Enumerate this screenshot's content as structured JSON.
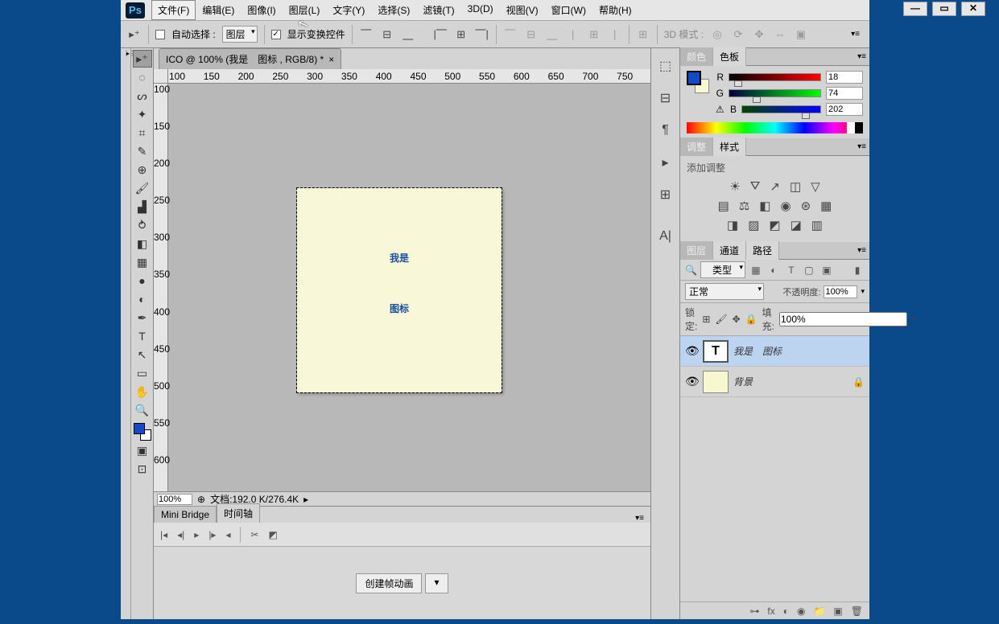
{
  "menu": [
    "文件(F)",
    "编辑(E)",
    "图像(I)",
    "图层(L)",
    "文字(Y)",
    "选择(S)",
    "滤镜(T)",
    "3D(D)",
    "视图(V)",
    "窗口(W)",
    "帮助(H)"
  ],
  "opt": {
    "auto": "自动选择 :",
    "layerSel": "图层",
    "show": "显示变换控件",
    "mode": "3D 模式 :"
  },
  "doc": {
    "tab": "ICO @ 100% (我是　图标 , RGB/8) *"
  },
  "rulerH": [
    "100",
    "150",
    "200",
    "250",
    "300",
    "350",
    "400",
    "450",
    "500",
    "550",
    "600",
    "650",
    "700",
    "750"
  ],
  "rulerV": [
    "100",
    "150",
    "200",
    "250",
    "300",
    "350",
    "400",
    "450",
    "500",
    "550",
    "600"
  ],
  "canvas": {
    "line1": "我是",
    "line2": "图标"
  },
  "status": {
    "zoom": "100%",
    "doc": "文档:192.0 K/276.4K"
  },
  "colorPnl": {
    "tab1": "颜色",
    "tab2": "色板",
    "r": "18",
    "g": "74",
    "b": "202",
    "rl": "R",
    "gl": "G",
    "bl": "B"
  },
  "adjPnl": {
    "tab1": "调整",
    "tab2": "样式",
    "add": "添加调整"
  },
  "layersPnl": {
    "tab1": "图层",
    "tab2": "通道",
    "tab3": "路径",
    "filter": "类型",
    "blend": "正常",
    "opLbl": "不透明度:",
    "op": "100%",
    "lockLbl": "锁定:",
    "fillLbl": "填充:",
    "fill": "100%"
  },
  "layers": [
    {
      "name": "我是　图标",
      "type": "T",
      "sel": true,
      "locked": false
    },
    {
      "name": "背景",
      "type": "bg",
      "sel": false,
      "locked": true
    }
  ],
  "botTabs": [
    "Mini Bridge",
    "时间轴"
  ],
  "bot": {
    "btn": "创建帧动画"
  },
  "swatchColor": "#124aca"
}
